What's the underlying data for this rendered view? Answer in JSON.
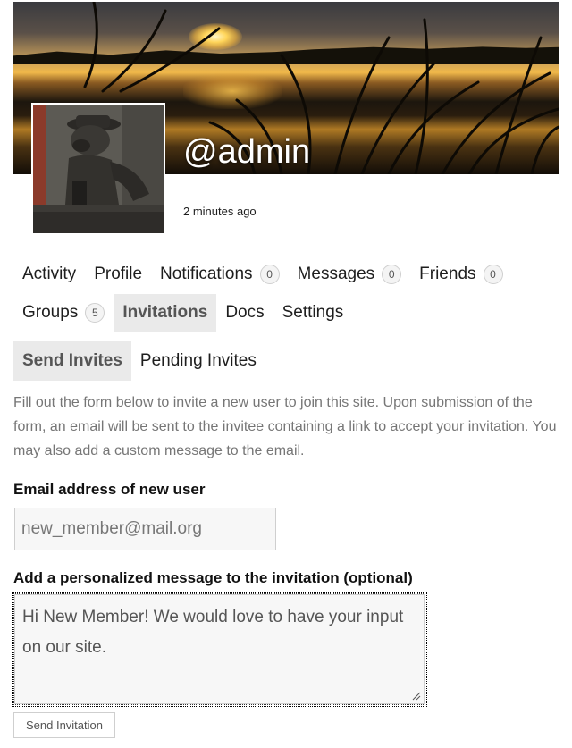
{
  "profile": {
    "handle": "@admin",
    "last_active": "2 minutes ago"
  },
  "nav": {
    "items": [
      {
        "label": "Activity"
      },
      {
        "label": "Profile"
      },
      {
        "label": "Notifications",
        "count": "0"
      },
      {
        "label": "Messages",
        "count": "0"
      },
      {
        "label": "Friends",
        "count": "0"
      },
      {
        "label": "Groups",
        "count": "5"
      },
      {
        "label": "Invitations",
        "active": true
      },
      {
        "label": "Docs"
      },
      {
        "label": "Settings"
      }
    ]
  },
  "subnav": {
    "items": [
      {
        "label": "Send Invites",
        "active": true
      },
      {
        "label": "Pending Invites"
      }
    ]
  },
  "form": {
    "intro": "Fill out the form below to invite a new user to join this site. Upon submission of the form, an email will be sent to the invitee containing a link to accept your invitation. You may also add a custom message to the email.",
    "email_label": "Email address of new user",
    "email_placeholder": "new_member@mail.org",
    "email_value": "",
    "message_label": "Add a personalized message to the invitation (optional)",
    "message_value": "Hi New Member! We would love to have your input on our site.",
    "submit_label": "Send Invitation"
  },
  "icons": {
    "cover": "sunset-lake-cover-image",
    "avatar": "statue-avatar-image",
    "resize": "resize-grip-icon"
  }
}
